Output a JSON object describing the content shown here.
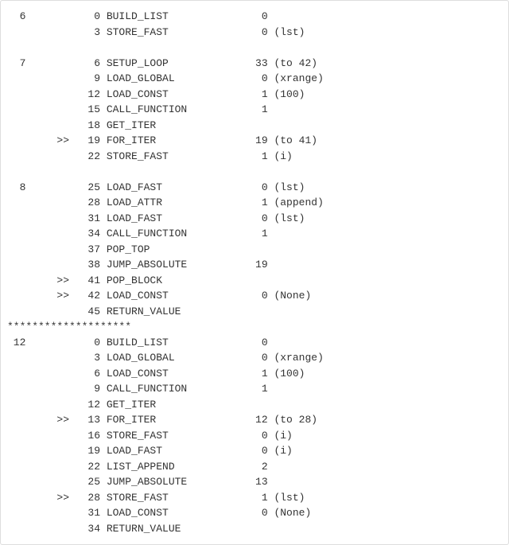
{
  "lines": [
    "  6           0 BUILD_LIST               0",
    "              3 STORE_FAST               0 (lst)",
    "",
    "  7           6 SETUP_LOOP              33 (to 42)",
    "              9 LOAD_GLOBAL              0 (xrange)",
    "             12 LOAD_CONST               1 (100)",
    "             15 CALL_FUNCTION            1",
    "             18 GET_ITER",
    "        >>   19 FOR_ITER                19 (to 41)",
    "             22 STORE_FAST               1 (i)",
    "",
    "  8          25 LOAD_FAST                0 (lst)",
    "             28 LOAD_ATTR                1 (append)",
    "             31 LOAD_FAST                0 (lst)",
    "             34 CALL_FUNCTION            1",
    "             37 POP_TOP",
    "             38 JUMP_ABSOLUTE           19",
    "        >>   41 POP_BLOCK",
    "        >>   42 LOAD_CONST               0 (None)",
    "             45 RETURN_VALUE",
    "********************",
    " 12           0 BUILD_LIST               0",
    "              3 LOAD_GLOBAL              0 (xrange)",
    "              6 LOAD_CONST               1 (100)",
    "              9 CALL_FUNCTION            1",
    "             12 GET_ITER",
    "        >>   13 FOR_ITER                12 (to 28)",
    "             16 STORE_FAST               0 (i)",
    "             19 LOAD_FAST                0 (i)",
    "             22 LIST_APPEND              2",
    "             25 JUMP_ABSOLUTE           13",
    "        >>   28 STORE_FAST               1 (lst)",
    "             31 LOAD_CONST               0 (None)",
    "             34 RETURN_VALUE"
  ]
}
